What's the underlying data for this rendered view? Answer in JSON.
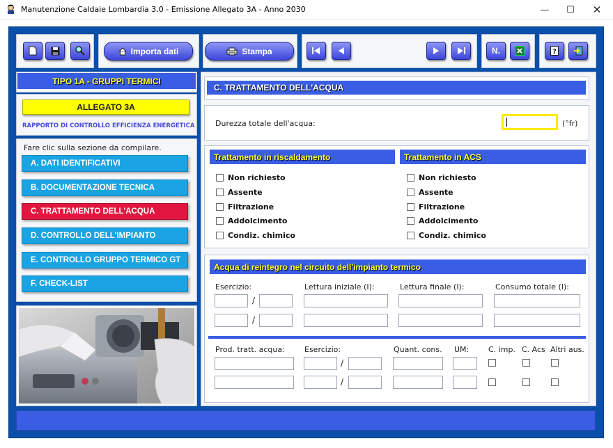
{
  "window": {
    "title": "Manutenzione Caldaie Lombardia 3.0 - Emissione Allegato 3A - Anno 2030"
  },
  "toolbar": {
    "import_label": "Importa dati",
    "print_label": "Stampa",
    "n_label": "N."
  },
  "sidebar": {
    "type_header": "TIPO 1A - GRUPPI TERMICI",
    "allegato_label": "ALLEGATO 3A",
    "allegato_subtitle": "RAPPORTO DI CONTROLLO EFFICIENZA ENERGETICA",
    "instruction": "Fare clic sulla sezione da compilare.",
    "sections": [
      {
        "label": "A. DATI IDENTIFICATIVI"
      },
      {
        "label": "B. DOCUMENTAZIONE TECNICA"
      },
      {
        "label": "C. TRATTAMENTO DELL'ACQUA"
      },
      {
        "label": "D. CONTROLLO DELL'IMPIANTO"
      },
      {
        "label": "E. CONTROLLO GRUPPO TERMICO GT"
      },
      {
        "label": "F. CHECK-LIST"
      }
    ]
  },
  "main": {
    "section_title": "C. TRATTAMENTO DELL'ACQUA",
    "hardness": {
      "label": "Durezza totale dell'acqua:",
      "value": "",
      "unit": "(°fr)"
    },
    "heating": {
      "title": "Trattamento in riscaldamento",
      "options": [
        "Non richiesto",
        "Assente",
        "Filtrazione",
        "Addolcimento",
        "Condiz. chimico"
      ]
    },
    "acs": {
      "title": "Trattamento in ACS",
      "options": [
        "Non richiesto",
        "Assente",
        "Filtrazione",
        "Addolcimento",
        "Condiz. chimico"
      ]
    },
    "reintegro": {
      "title": "Acqua di reintegro nel circuito dell'impianto termico",
      "col_esercizio": "Esercizio:",
      "col_lettura_iniziale": "Lettura iniziale (I):",
      "col_lettura_finale": "Lettura finale (I):",
      "col_consumo": "Consumo totale (I):",
      "separator": "/"
    },
    "prodotti": {
      "col_prod": "Prod. tratt. acqua:",
      "col_esercizio": "Esercizio:",
      "col_quant": "Quant. cons.",
      "col_um": "UM:",
      "col_cimp": "C. imp.",
      "col_cacs": "C. Acs",
      "col_altri": "Altri aus."
    }
  },
  "colors": {
    "frame": "#0a4fa8",
    "header": "#3a5ee3",
    "menu": "#1aa4e3",
    "menu_active": "#e3163f",
    "allegato": "#ffff00"
  }
}
